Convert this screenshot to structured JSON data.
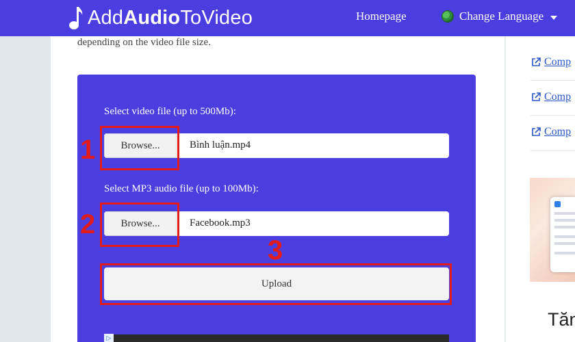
{
  "header": {
    "logo_prefix": "Add",
    "logo_bold": "Audio",
    "logo_suffix": "ToVideo",
    "nav_home": "Homepage",
    "nav_language": "Change Language"
  },
  "intro_text": "depending on the video file size.",
  "form": {
    "video_label": "Select video file (up to 500Mb):",
    "video_browse": "Browse...",
    "video_file": "Bình luận.mp4",
    "audio_label": "Select MP3 audio file (up to 100Mb):",
    "audio_browse": "Browse...",
    "audio_file": "Facebook.mp3",
    "upload_label": "Upload"
  },
  "annotations": [
    "1",
    "2",
    "3"
  ],
  "sidebar": {
    "links": [
      "Comp",
      "Comp",
      "Comp"
    ],
    "bottom_text": "Tăn"
  },
  "colors": {
    "brand": "#4a3ee0",
    "annotation_red": "#e11b1b",
    "link": "#2a56c6"
  }
}
